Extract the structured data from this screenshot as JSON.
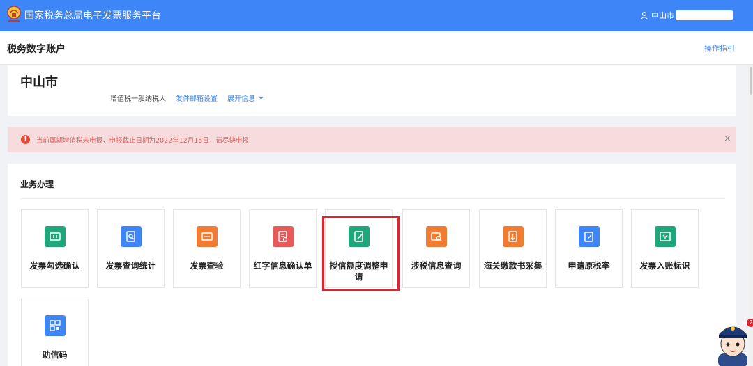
{
  "header": {
    "title": "国家税务总局电子发票服务平台",
    "user_name": "中山市"
  },
  "subheader": {
    "title": "税务数字账户",
    "guide_link": "操作指引"
  },
  "taxpayer": {
    "city": "中山市",
    "type": "增值税一般纳税人",
    "mail_link": "发件邮箱设置",
    "expand_link": "展开信息"
  },
  "alert": {
    "message": "当前属期增值税未申报，申报截止日期为2022年12月15日，请尽快申报",
    "close": "×"
  },
  "business": {
    "title": "业务办理",
    "tiles": [
      {
        "label": "发票勾选确认",
        "icon": "invoice-check-icon",
        "color": "#1fa67a"
      },
      {
        "label": "发票查询统计",
        "icon": "invoice-search-icon",
        "color": "#3e85f7"
      },
      {
        "label": "发票查验",
        "icon": "invoice-verify-icon",
        "color": "#f07c33"
      },
      {
        "label": "红字信息确认单",
        "icon": "red-invoice-icon",
        "color": "#e8595a"
      },
      {
        "label": "授信额度调整申请",
        "icon": "credit-adjust-icon",
        "color": "#1fa67a"
      },
      {
        "label": "涉税信息查询",
        "icon": "tax-info-search-icon",
        "color": "#f07c33"
      },
      {
        "label": "海关缴款书采集",
        "icon": "customs-payment-icon",
        "color": "#f07c33"
      },
      {
        "label": "申请原税率",
        "icon": "original-rate-icon",
        "color": "#3e85f7"
      },
      {
        "label": "发票入账标识",
        "icon": "invoice-entry-icon",
        "color": "#1fa67a"
      },
      {
        "label": "助信码",
        "icon": "qr-code-icon",
        "color": "#3e85f7"
      }
    ]
  },
  "mascot": {
    "badge": "2"
  },
  "colors": {
    "primary": "#3e85f7",
    "alert_bg": "#f6dcdc",
    "alert_text": "#d96363",
    "highlight": "#e0232f"
  }
}
